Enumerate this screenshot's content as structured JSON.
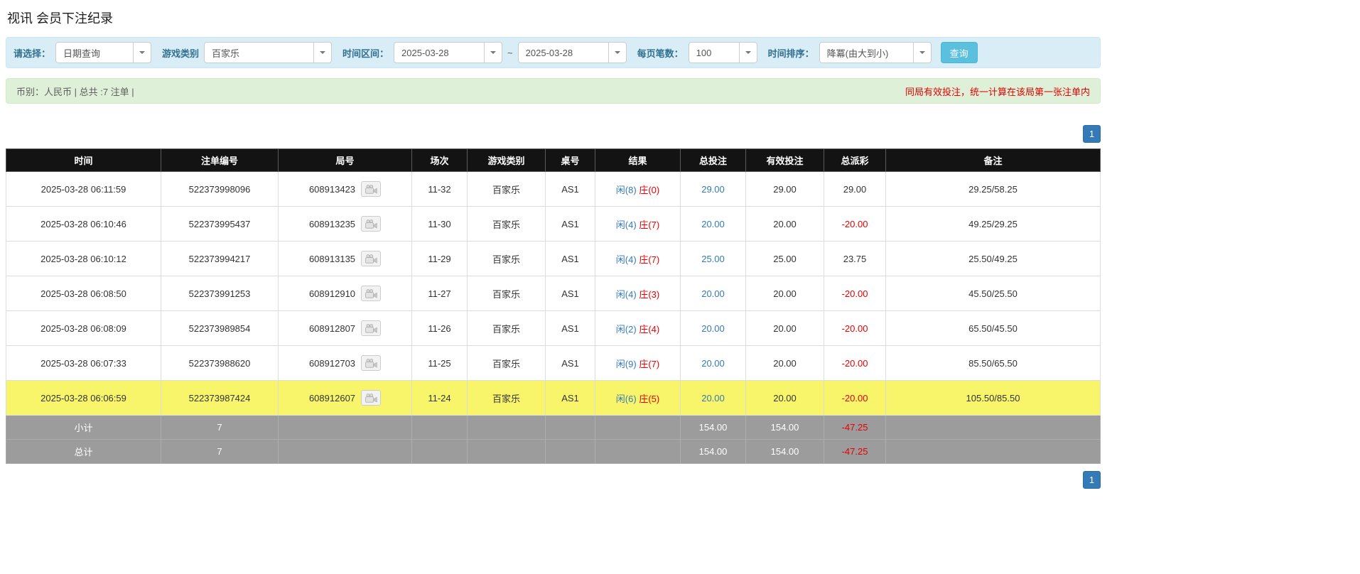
{
  "page": {
    "title": "视讯 会员下注纪录"
  },
  "filters": {
    "query_type": {
      "label": "请选择：",
      "value": "日期查询"
    },
    "game_type": {
      "label": "游戏类别",
      "value": "百家乐"
    },
    "time_range": {
      "label": "时间区间：",
      "from": "2025-03-28",
      "separator": "~",
      "to": "2025-03-28"
    },
    "per_page": {
      "label": "每页笔数：",
      "value": "100"
    },
    "sort": {
      "label": "时间排序：",
      "value": "降冪(由大到小)"
    },
    "query_button": "查询"
  },
  "summary": {
    "currency_info": "币别：人民币 | 总共 :7 注单 |",
    "notice": "同局有效投注，统一计算在该局第一张注单内"
  },
  "pagination": {
    "current_page": "1"
  },
  "table": {
    "headers": [
      "时间",
      "注单编号",
      "局号",
      "场次",
      "游戏类别",
      "桌号",
      "结果",
      "总投注",
      "有效投注",
      "总派彩",
      "备注"
    ],
    "rows": [
      {
        "time": "2025-03-28 06:11:59",
        "bet_id": "522373998096",
        "round_id": "608913423",
        "session": "11-32",
        "game": "百家乐",
        "table_no": "AS1",
        "result_player": "闲(8)",
        "result_banker": "庄(0)",
        "total_bet": "29.00",
        "valid_bet": "29.00",
        "payout": "29.00",
        "note": "29.25/58.25",
        "highlight": false
      },
      {
        "time": "2025-03-28 06:10:46",
        "bet_id": "522373995437",
        "round_id": "608913235",
        "session": "11-30",
        "game": "百家乐",
        "table_no": "AS1",
        "result_player": "闲(4)",
        "result_banker": "庄(7)",
        "total_bet": "20.00",
        "valid_bet": "20.00",
        "payout": "-20.00",
        "note": "49.25/29.25",
        "highlight": false
      },
      {
        "time": "2025-03-28 06:10:12",
        "bet_id": "522373994217",
        "round_id": "608913135",
        "session": "11-29",
        "game": "百家乐",
        "table_no": "AS1",
        "result_player": "闲(4)",
        "result_banker": "庄(7)",
        "total_bet": "25.00",
        "valid_bet": "25.00",
        "payout": "23.75",
        "note": "25.50/49.25",
        "highlight": false
      },
      {
        "time": "2025-03-28 06:08:50",
        "bet_id": "522373991253",
        "round_id": "608912910",
        "session": "11-27",
        "game": "百家乐",
        "table_no": "AS1",
        "result_player": "闲(4)",
        "result_banker": "庄(3)",
        "total_bet": "20.00",
        "valid_bet": "20.00",
        "payout": "-20.00",
        "note": "45.50/25.50",
        "highlight": false
      },
      {
        "time": "2025-03-28 06:08:09",
        "bet_id": "522373989854",
        "round_id": "608912807",
        "session": "11-26",
        "game": "百家乐",
        "table_no": "AS1",
        "result_player": "闲(2)",
        "result_banker": "庄(4)",
        "total_bet": "20.00",
        "valid_bet": "20.00",
        "payout": "-20.00",
        "note": "65.50/45.50",
        "highlight": false
      },
      {
        "time": "2025-03-28 06:07:33",
        "bet_id": "522373988620",
        "round_id": "608912703",
        "session": "11-25",
        "game": "百家乐",
        "table_no": "AS1",
        "result_player": "闲(9)",
        "result_banker": "庄(7)",
        "total_bet": "20.00",
        "valid_bet": "20.00",
        "payout": "-20.00",
        "note": "85.50/65.50",
        "highlight": false
      },
      {
        "time": "2025-03-28 06:06:59",
        "bet_id": "522373987424",
        "round_id": "608912607",
        "session": "11-24",
        "game": "百家乐",
        "table_no": "AS1",
        "result_player": "闲(6)",
        "result_banker": "庄(5)",
        "total_bet": "20.00",
        "valid_bet": "20.00",
        "payout": "-20.00",
        "note": "105.50/85.50",
        "highlight": true
      }
    ],
    "subtotal": {
      "label": "小计",
      "count": "7",
      "total_bet": "154.00",
      "valid_bet": "154.00",
      "payout": "-47.25",
      "note": ""
    },
    "grand_total": {
      "label": "总计",
      "count": "7",
      "total_bet": "154.00",
      "valid_bet": "154.00",
      "payout": "-47.25",
      "note": ""
    }
  },
  "colors": {
    "accent_blue": "#337ab7",
    "banker_red": "#e60000",
    "player_blue": "#337ab7",
    "highlight_yellow": "#f8f56b",
    "filter_bg": "#d9edf7",
    "summary_bg": "#dff0d8",
    "header_bg": "#131313",
    "total_row_bg": "#9c9c9c"
  }
}
